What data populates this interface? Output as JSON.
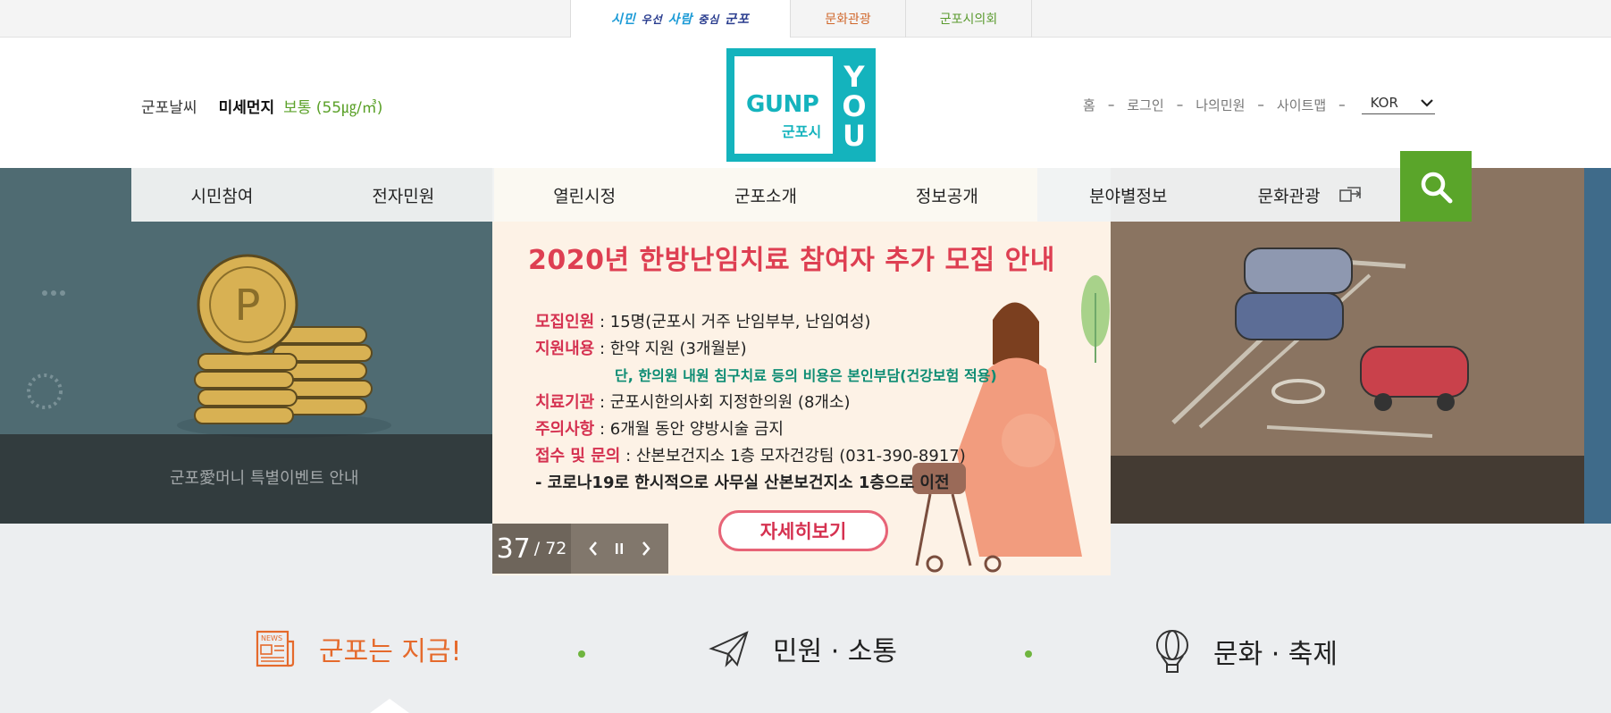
{
  "top_tabs": {
    "slogan": {
      "part1": "시민",
      "part2": "우선",
      "part3": "사람",
      "part4": "중심",
      "part5": "군포"
    },
    "culture": "문화관광",
    "council": "군포시의회"
  },
  "weather": {
    "label": "군포날씨",
    "dust_label": "미세먼지",
    "dust_value": "보통 (55㎍/㎥)"
  },
  "logo": {
    "brand": "GUNP",
    "city": "군포시",
    "letters": [
      "Y",
      "O",
      "U"
    ]
  },
  "util_links": {
    "home": "홈",
    "login": "로그인",
    "my": "나의민원",
    "sitemap": "사이트맵",
    "sep": "–",
    "lang": "KOR"
  },
  "gnb": [
    "시민참여",
    "전자민원",
    "열린시정",
    "군포소개",
    "정보공개",
    "분야별정보",
    "문화관광"
  ],
  "slides": {
    "left_caption": "군포愛머니 특별이벤트 안내",
    "center": {
      "title": "2020년 한방난임치료 참여자 추가 모집 안내",
      "rows": [
        {
          "k": "모집인원",
          "v": "15명(군포시 거주 난임부부, 난임여성)"
        },
        {
          "k": "지원내용",
          "v": "한약 지원 (3개월분)"
        },
        {
          "k": "치료기관",
          "v": "군포시한의사회 지정한의원 (8개소)"
        },
        {
          "k": "주의사항",
          "v": "6개월 동안 양방시술 금지"
        },
        {
          "k": "접수 및 문의",
          "v": "산본보건지소 1층 모자건강팀 (031-390-8917)"
        }
      ],
      "note": "단, 한의원 내원 침구치료 등의 비용은 본인부담(건강보험 적용)",
      "notice": "- 코로나19로 한시적으로 사무실 산본보건지소 1층으로 이전",
      "more": "자세히보기"
    },
    "current": "37",
    "total": "/ 72"
  },
  "categories": {
    "news": "군포는 지금!",
    "civil": "민원 · 소통",
    "culture": "문화 · 축제"
  },
  "colors": {
    "brand_teal": "#14b3bd",
    "search_green": "#5aa52a",
    "accent_orange": "#e56a2c",
    "accent_red": "#de3f52"
  }
}
